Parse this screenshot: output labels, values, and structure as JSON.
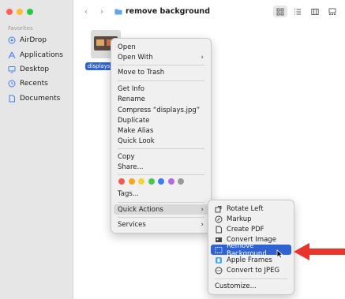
{
  "sidebar": {
    "section_header": "Favorites",
    "items": [
      {
        "label": "AirDrop",
        "icon": "airdrop-icon"
      },
      {
        "label": "Applications",
        "icon": "applications-icon"
      },
      {
        "label": "Desktop",
        "icon": "desktop-icon"
      },
      {
        "label": "Recents",
        "icon": "clock-icon"
      },
      {
        "label": "Documents",
        "icon": "document-icon"
      }
    ]
  },
  "toolbar": {
    "folder_title": "remove background",
    "back_glyph": "‹",
    "forward_glyph": "›"
  },
  "file": {
    "label": "displays.jpg"
  },
  "context_menu": {
    "open": "Open",
    "open_with": "Open With",
    "move_to_trash": "Move to Trash",
    "get_info": "Get Info",
    "rename": "Rename",
    "compress": "Compress “displays.jpg”",
    "duplicate": "Duplicate",
    "make_alias": "Make Alias",
    "quick_look": "Quick Look",
    "copy": "Copy",
    "share": "Share...",
    "tags": "Tags...",
    "quick_actions": "Quick Actions",
    "services": "Services",
    "submenu_glyph": "›"
  },
  "tag_colors": [
    "#ef5b4f",
    "#f5a623",
    "#f7d23e",
    "#4cc552",
    "#3d7cf2",
    "#b16bdb",
    "#9a9a9a"
  ],
  "quick_actions_menu": {
    "rotate_left": "Rotate Left",
    "markup": "Markup",
    "create_pdf": "Create PDF",
    "convert_image": "Convert Image",
    "remove_background": "Remove Background",
    "apple_frames": "Apple Frames",
    "convert_to_jpeg": "Convert to JPEG",
    "customize": "Customize..."
  },
  "colors": {
    "selection_blue": "#2f63d1",
    "arrow_red": "#e8342a"
  }
}
